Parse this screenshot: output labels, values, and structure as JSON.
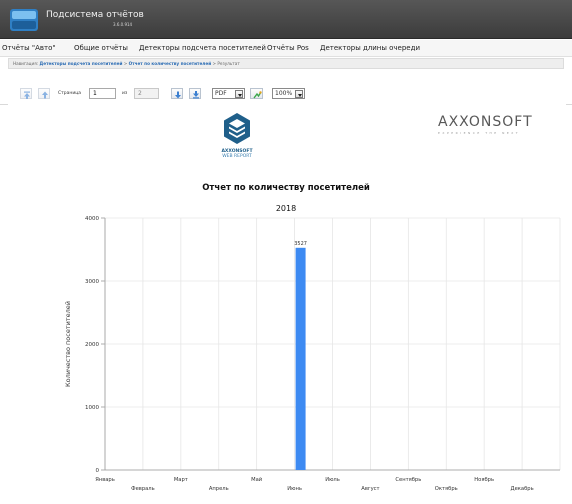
{
  "app": {
    "title": "Подсистема отчётов",
    "version": "3.6.0.914"
  },
  "menu": {
    "items": [
      {
        "label": "Отчёты \"Авто\""
      },
      {
        "label": "Общие отчёты"
      },
      {
        "label": "Детекторы подсчета посетителей"
      },
      {
        "label": "Отчёты Pos"
      },
      {
        "label": "Детекторы длины очереди"
      }
    ]
  },
  "breadcrumb": {
    "prefix": "Навигация:",
    "link1": "Детекторы подсчета посетителей",
    "sep": ">",
    "link2": "Отчет по количеству посетителей",
    "current": "Результат"
  },
  "toolbar": {
    "page_label": "Страница",
    "page_value": "1",
    "of_label": "из",
    "total_pages": "2",
    "export_format": "PDF",
    "zoom": "100%"
  },
  "report": {
    "logo_line1": "AXXONSOFT",
    "logo_line2": "WEB REPORT",
    "brand_name": "AXXONSOFT",
    "brand_tagline": "EXPERIENCE THE NEXT"
  },
  "chart_data": {
    "type": "bar",
    "title": "Отчет по количеству посетителей",
    "subtitle": "2018",
    "ylabel": "Количество посетителей",
    "xlabel": "",
    "categories": [
      "Январь",
      "Февраль",
      "Март",
      "Апрель",
      "Май",
      "Июнь",
      "Июль",
      "Август",
      "Сентябрь",
      "Октябрь",
      "Ноябрь",
      "Декабрь"
    ],
    "values": [
      0,
      0,
      0,
      0,
      0,
      3527,
      0,
      0,
      0,
      0,
      0,
      0
    ],
    "data_labels": [
      "",
      "",
      "",
      "",
      "",
      "3527",
      "",
      "",
      "",
      "",
      "",
      ""
    ],
    "ylim": [
      0,
      4000
    ],
    "yticks": [
      0,
      1000,
      2000,
      3000,
      4000
    ],
    "ytick_labels": [
      "0",
      "1000",
      "2000",
      "3000",
      "4000"
    ],
    "grid": true,
    "colors": {
      "bar": "#3d8af2",
      "grid": "#e6e6e6",
      "axis": "#999999"
    }
  }
}
